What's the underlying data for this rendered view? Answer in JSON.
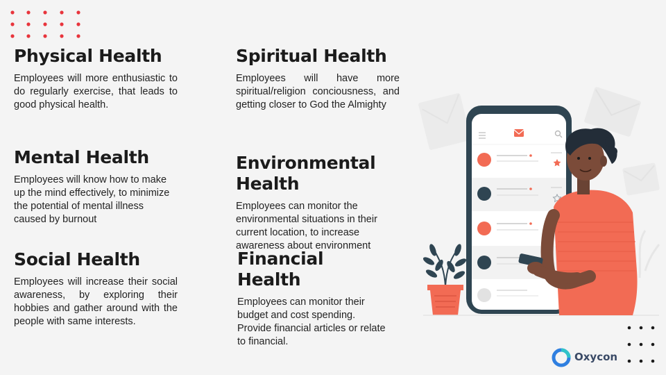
{
  "sections": {
    "physical": {
      "title": "Physical Health",
      "text": "Employees will more enthusiastic to do regularly exercise, that leads to good physical health."
    },
    "mental": {
      "title": "Mental Health",
      "text": "Employees will know how to make up the mind effectively, to minimize the potential of mental illness caused by burnout"
    },
    "social": {
      "title": "Social Health",
      "text": "Employees will increase their social awareness, by exploring their hobbies and gather around with the people with same interests."
    },
    "spiritual": {
      "title": "Spiritual Health",
      "text": "Employees will have more spiritual/religion conciousness, and getting closer to God the Almighty"
    },
    "environmental": {
      "title": "Environmental Health",
      "text": "Employees can monitor the environmental situations in their current location, to increase awareness about environment"
    },
    "financial": {
      "title": "Financial Health",
      "text": "Employees can monitor their budget and cost spending. Provide financial articles or relate to financial."
    }
  },
  "logo": {
    "name": "Oxycon"
  },
  "colors": {
    "accent_red": "#e8343c",
    "coral": "#f26b54",
    "dark_slate": "#2f4552",
    "logo_blue": "#2f7fe0",
    "logo_teal": "#31c3c9",
    "text_dark": "#1b1b1b"
  },
  "icons": [
    "mail-icon",
    "menu-icon",
    "search-icon",
    "star-icon",
    "plant-icon"
  ]
}
